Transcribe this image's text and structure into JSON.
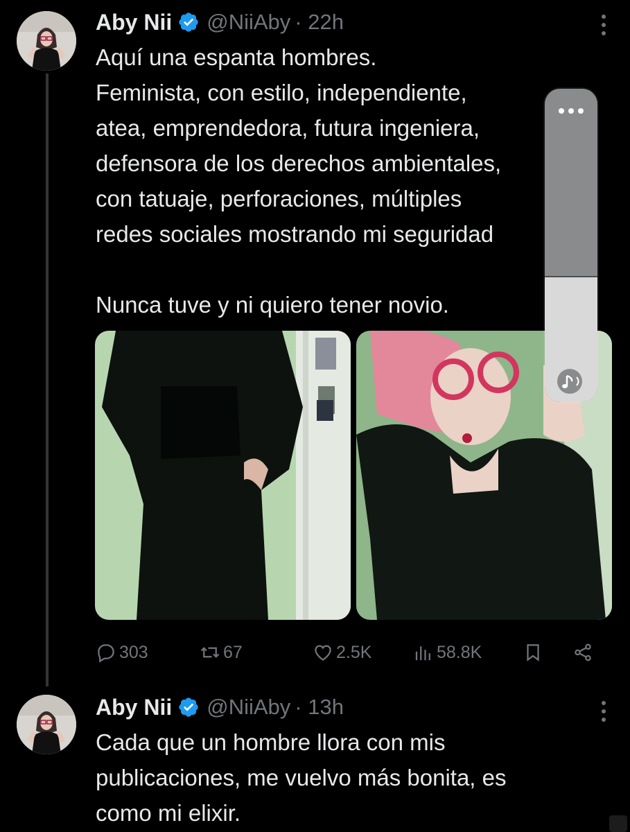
{
  "tweets": [
    {
      "name": "Aby Nii",
      "handle": "@NiiAby",
      "time": "· 22h",
      "text": "Aquí una espanta hombres.\nFeminista, con estilo, independiente,\natea, emprendedora, futura ingeniera,\ndefensora de los derechos ambientales,\ncon tatuaje, perforaciones, múltiples\nredes sociales mostrando mi seguridad\n\nNunca tuve y ni quiero tener novio.",
      "stats": {
        "replies": "303",
        "reposts": "67",
        "likes": "2.5K",
        "views": "58.8K"
      }
    },
    {
      "name": "Aby Nii",
      "handle": "@NiiAby",
      "time": "· 13h",
      "text": "Cada que un hombre llora con mis\npublicaciones, me vuelvo más bonita, es\ncomo mi elixir."
    }
  ],
  "colors": {
    "background": "#000000",
    "text": "#e7e9ea",
    "muted": "#71767b",
    "verified": "#1d9bf0",
    "thread_line": "#333639"
  },
  "icons": [
    "verified-badge-icon",
    "more-icon",
    "reply-icon",
    "repost-icon",
    "like-icon",
    "views-icon",
    "bookmark-icon",
    "share-icon",
    "music-note-icon"
  ]
}
